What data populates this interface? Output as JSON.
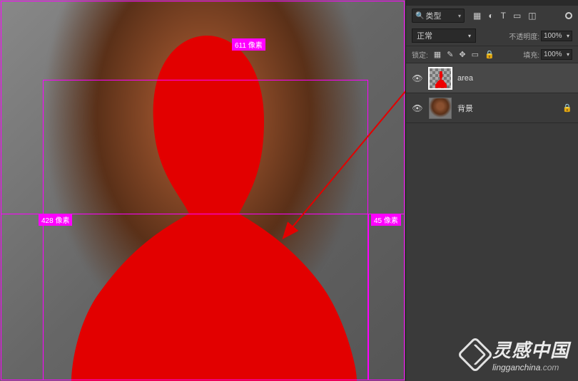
{
  "canvas": {
    "measurements": {
      "top": "611 像素",
      "left": "428 像素",
      "right": "45 像素"
    }
  },
  "layers_panel": {
    "filter": {
      "search_icon": "search-icon",
      "type_label": "类型",
      "icons": {
        "image": "▦",
        "adjust": "◐",
        "text": "T",
        "shape": "▭",
        "smart": "◫"
      }
    },
    "blend": {
      "mode": "正常",
      "opacity_label": "不透明度:",
      "opacity_value": "100%"
    },
    "lock": {
      "label": "锁定:",
      "fill_label": "填充:",
      "fill_value": "100%"
    },
    "layers": [
      {
        "name": "area",
        "visible": true,
        "selected": true,
        "locked": false,
        "thumb": "red"
      },
      {
        "name": "背景",
        "visible": true,
        "selected": false,
        "locked": true,
        "thumb": "photo"
      }
    ]
  },
  "watermark": {
    "cn": "灵感中国",
    "en_bold": "lingganchina",
    "en_thin": ".com"
  }
}
